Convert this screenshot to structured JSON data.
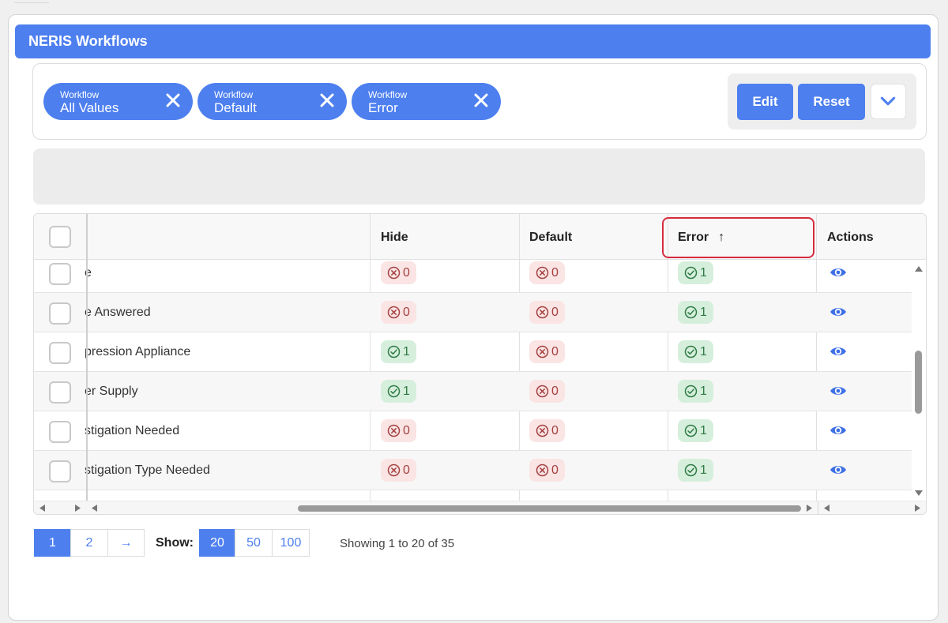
{
  "header": {
    "title": "NERIS Workflows"
  },
  "filters": [
    {
      "key": "Workflow",
      "value": "All Values"
    },
    {
      "key": "Workflow",
      "value": "Default"
    },
    {
      "key": "Workflow",
      "value": "Error"
    }
  ],
  "toolbar": {
    "edit_label": "Edit",
    "reset_label": "Reset"
  },
  "table": {
    "columns": {
      "hide": "Hide",
      "default": "Default",
      "error": "Error",
      "error_sort_icon": "↑",
      "actions": "Actions"
    },
    "rows": [
      {
        "name": "e",
        "hide": "0",
        "default": "0",
        "error": "1"
      },
      {
        "name": "e Answered",
        "hide": "0",
        "default": "0",
        "error": "1"
      },
      {
        "name": "pression Appliance",
        "hide": "1",
        "default": "0",
        "error": "1"
      },
      {
        "name": "er Supply",
        "hide": "1",
        "default": "0",
        "error": "1"
      },
      {
        "name": "stigation Needed",
        "hide": "0",
        "default": "0",
        "error": "1"
      },
      {
        "name": "stigation Type Needed",
        "hide": "0",
        "default": "0",
        "error": "1"
      }
    ]
  },
  "pagination": {
    "pages": [
      "1",
      "2"
    ],
    "next_label": "→",
    "show_label": "Show:",
    "sizes": [
      "20",
      "50",
      "100"
    ],
    "status": "Showing 1 to 20 of 35"
  },
  "colors": {
    "accent": "#4d7fef",
    "highlight": "#d62b3c",
    "yes_bg": "#d6efdc",
    "no_bg": "#fae4e4"
  }
}
